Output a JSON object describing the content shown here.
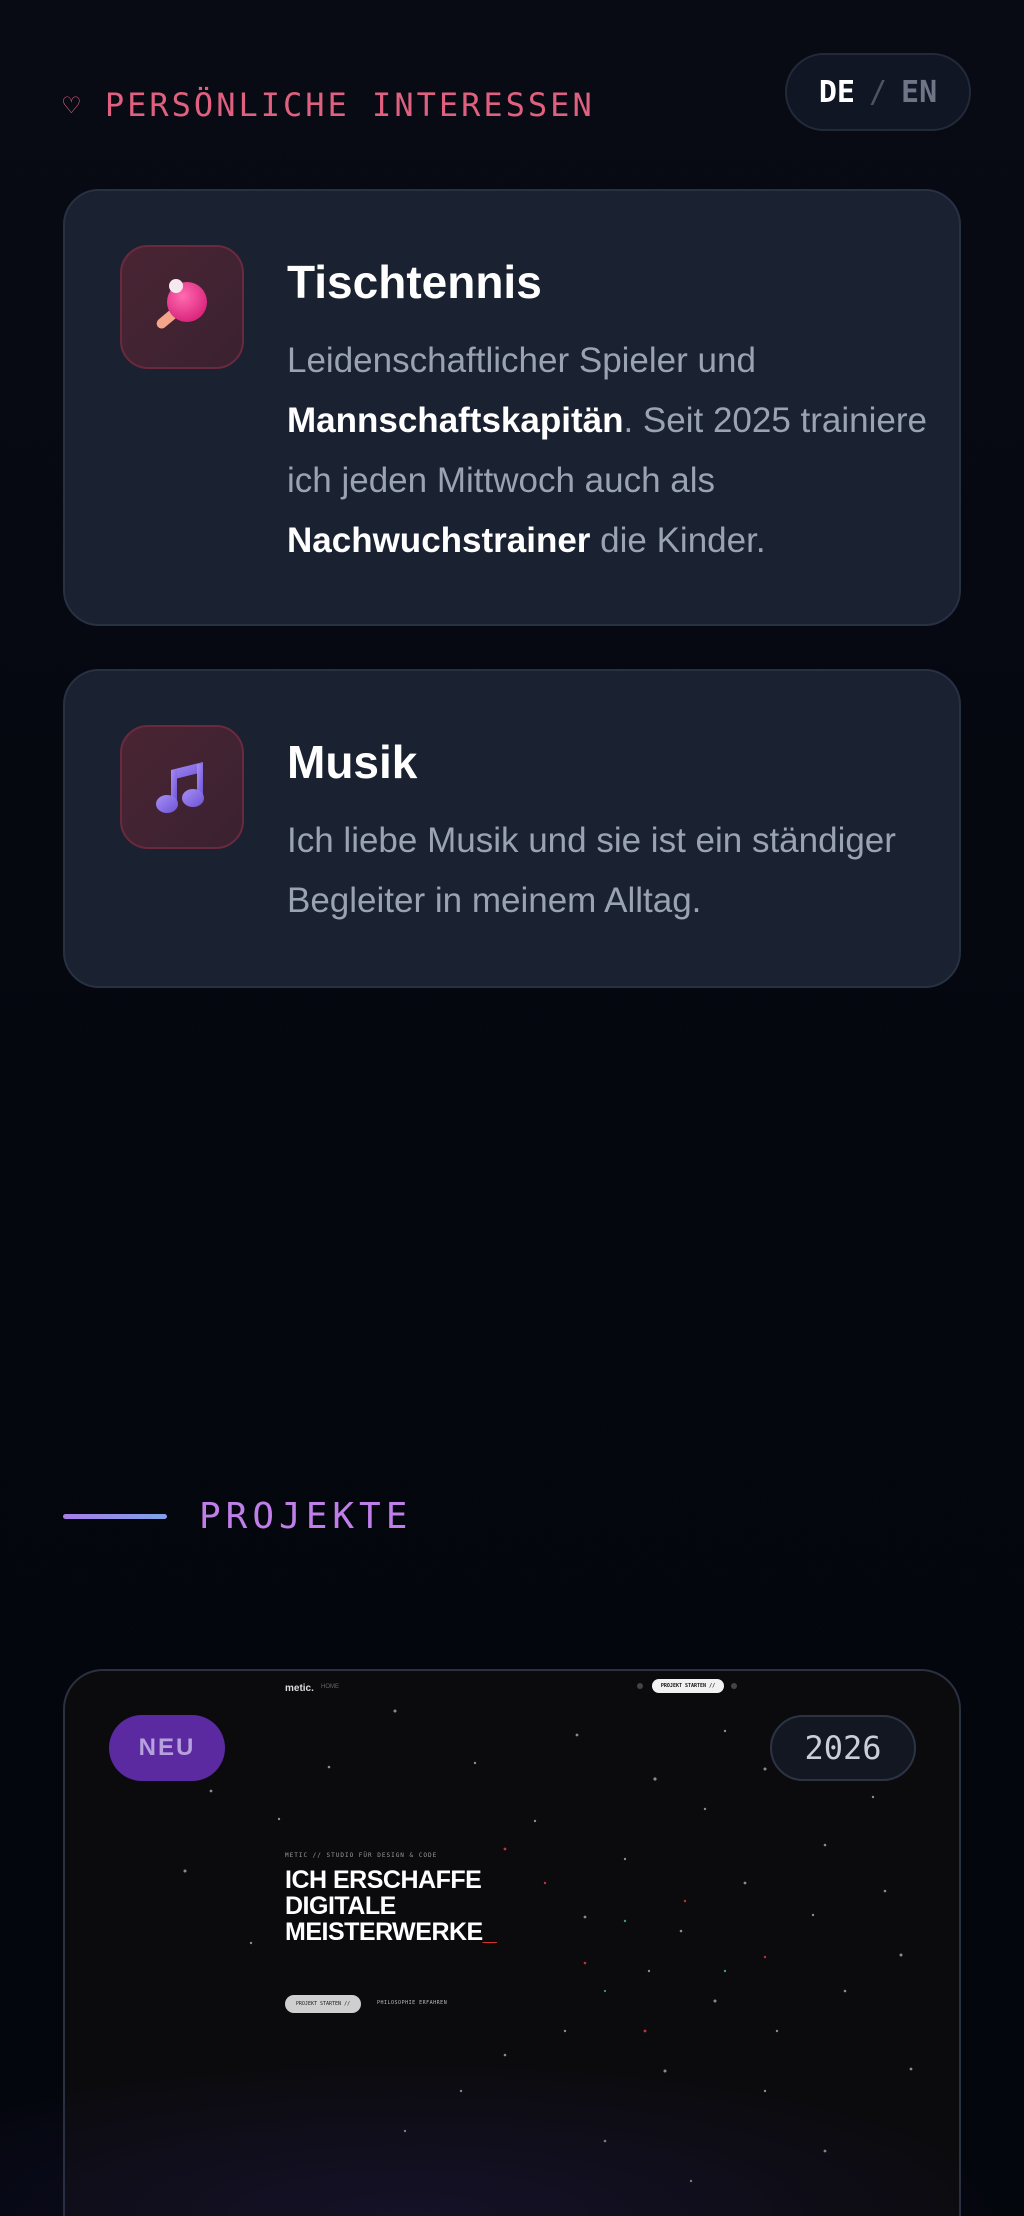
{
  "language_switch": {
    "active": "DE",
    "separator": "/",
    "inactive": "EN"
  },
  "interests": {
    "heading": "PERSÖNLICHE INTERESSEN",
    "heading_icon": "heart-icon",
    "items": [
      {
        "icon": "ping-pong-paddle-icon",
        "title": "Tischtennis",
        "text_parts": [
          "Leidenschaftlicher Spieler und ",
          "Mannschaftskapitän",
          ". Seit 2025 trainiere ich jeden Mittwoch auch als ",
          "Nachwuchstrainer",
          " die Kinder."
        ]
      },
      {
        "icon": "music-note-icon",
        "title": "Musik",
        "text": "Ich liebe Musik und sie ist ein ständiger Begleiter in meinem Alltag."
      }
    ]
  },
  "projects": {
    "heading": "PROJEKTE",
    "featured": {
      "badge": "NEU",
      "year": "2026",
      "preview": {
        "logo": "metic.",
        "nav_home": "HOME",
        "cta": "PROJEKT STARTEN //",
        "kicker": "METIC // STUDIO FÜR DESIGN & CODE",
        "title_line1": "ICH ERSCHAFFE",
        "title_line2": "DIGITALE",
        "title_line3": "MEISTERWERKE",
        "title_cursor": "_",
        "button_primary": "PROJEKT STARTEN //",
        "button_secondary": "PHILOSOPHIE ERFAHREN"
      }
    }
  },
  "colors": {
    "accent_pink": "#e0607f",
    "accent_purple": "#c07ee8",
    "card_bg": "#1a2130",
    "badge_purple": "#5b2aa0"
  }
}
